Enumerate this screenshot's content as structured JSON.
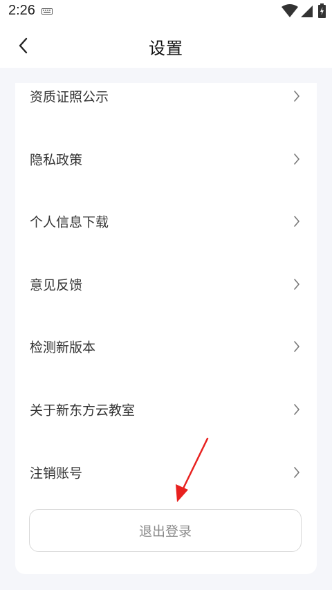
{
  "status_bar": {
    "time": "2:26",
    "icons": [
      "keyboard-icon",
      "wifi-icon",
      "signal-icon",
      "battery-icon"
    ]
  },
  "header": {
    "title": "设置",
    "back_icon": "chevron-left-icon"
  },
  "menu": {
    "items": [
      {
        "label": "资质证照公示"
      },
      {
        "label": "隐私政策"
      },
      {
        "label": "个人信息下载"
      },
      {
        "label": "意见反馈"
      },
      {
        "label": "检测新版本"
      },
      {
        "label": "关于新东方云教室"
      },
      {
        "label": "注销账号"
      }
    ],
    "chevron_icon": "chevron-right-icon"
  },
  "logout": {
    "label": "退出登录"
  },
  "colors": {
    "background": "#f5f6fa",
    "card": "#ffffff",
    "annotation_arrow": "#e8211f"
  }
}
